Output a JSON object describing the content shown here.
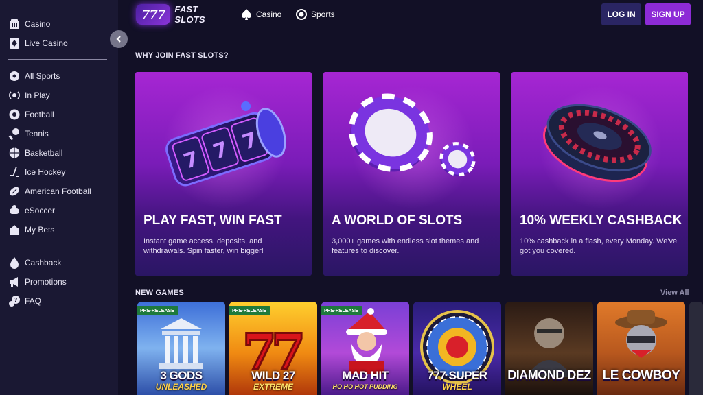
{
  "sidebar": {
    "items_top": [
      {
        "label": "Casino",
        "icon": "casino-icon"
      },
      {
        "label": "Live Casino",
        "icon": "live-casino-icon"
      }
    ],
    "items_sports": [
      {
        "label": "All Sports",
        "icon": "all-sports-icon"
      },
      {
        "label": "In Play",
        "icon": "in-play-icon"
      },
      {
        "label": "Football",
        "icon": "football-icon"
      },
      {
        "label": "Tennis",
        "icon": "tennis-icon"
      },
      {
        "label": "Basketball",
        "icon": "basketball-icon"
      },
      {
        "label": "Ice Hockey",
        "icon": "ice-hockey-icon"
      },
      {
        "label": "American Football",
        "icon": "american-football-icon"
      },
      {
        "label": "eSoccer",
        "icon": "esoccer-icon"
      },
      {
        "label": "My Bets",
        "icon": "my-bets-icon"
      }
    ],
    "items_bottom": [
      {
        "label": "Cashback",
        "icon": "cashback-icon"
      },
      {
        "label": "Promotions",
        "icon": "promotions-icon"
      },
      {
        "label": "FAQ",
        "icon": "faq-icon"
      }
    ]
  },
  "header": {
    "logo_mark": "777",
    "logo_text": "FAST SLOTS",
    "nav": [
      {
        "label": "Casino",
        "icon": "spade-icon"
      },
      {
        "label": "Sports",
        "icon": "sports-ball-icon"
      }
    ],
    "login_label": "LOG IN",
    "signup_label": "SIGN UP"
  },
  "why_join": {
    "title": "WHY JOIN FAST SLOTS?",
    "cards": [
      {
        "title": "PLAY FAST, WIN FAST",
        "text": "Instant game access, deposits, and withdrawals. Spin faster, win bigger!"
      },
      {
        "title": "A WORLD OF SLOTS",
        "text": "3,000+ games with endless slot themes and features to discover."
      },
      {
        "title": "10% WEEKLY CASHBACK",
        "text": "10% cashback in a flash, every Monday. We've got you covered."
      }
    ]
  },
  "new_games": {
    "title": "NEW GAMES",
    "view_all": "View All",
    "games": [
      {
        "badge": "PRE-RELEASE",
        "name": "3 GODS",
        "subtitle": "UNLEASHED"
      },
      {
        "badge": "PRE-RELEASE",
        "name": "WILD 27",
        "subtitle": "EXTREME"
      },
      {
        "badge": "PRE-RELEASE",
        "name": "MAD HIT",
        "subtitle": "HO HO HOT PUDDING"
      },
      {
        "badge": "",
        "name": "777 SUPER",
        "subtitle": "WHEEL"
      },
      {
        "badge": "",
        "name": "DIAMOND DEZ",
        "subtitle": ""
      },
      {
        "badge": "",
        "name": "LE COWBOY",
        "subtitle": ""
      }
    ]
  },
  "colors": {
    "background": "#121026",
    "sidebar": "#1a1833",
    "accent": "#8d2bd6",
    "login": "#2a2563",
    "badge": "#1e7a3c"
  }
}
